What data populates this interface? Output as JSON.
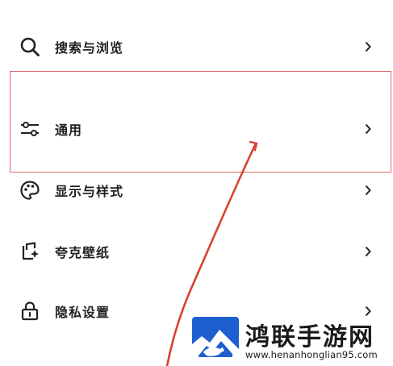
{
  "menu": {
    "items": [
      {
        "label": "搜索与浏览",
        "icon": "search-icon"
      },
      {
        "label": "通用",
        "icon": "sliders-icon"
      },
      {
        "label": "显示与样式",
        "icon": "palette-icon"
      },
      {
        "label": "夸克壁纸",
        "icon": "wallpaper-icon"
      },
      {
        "label": "隐私设置",
        "icon": "lock-icon"
      }
    ]
  },
  "annotation": {
    "highlight_color": "#e06666",
    "arrow_color": "#d9412f"
  },
  "watermark": {
    "title": "鸿联手游网",
    "url": "www.henanhonglian95.com",
    "brand_color": "#1e5fd0"
  }
}
